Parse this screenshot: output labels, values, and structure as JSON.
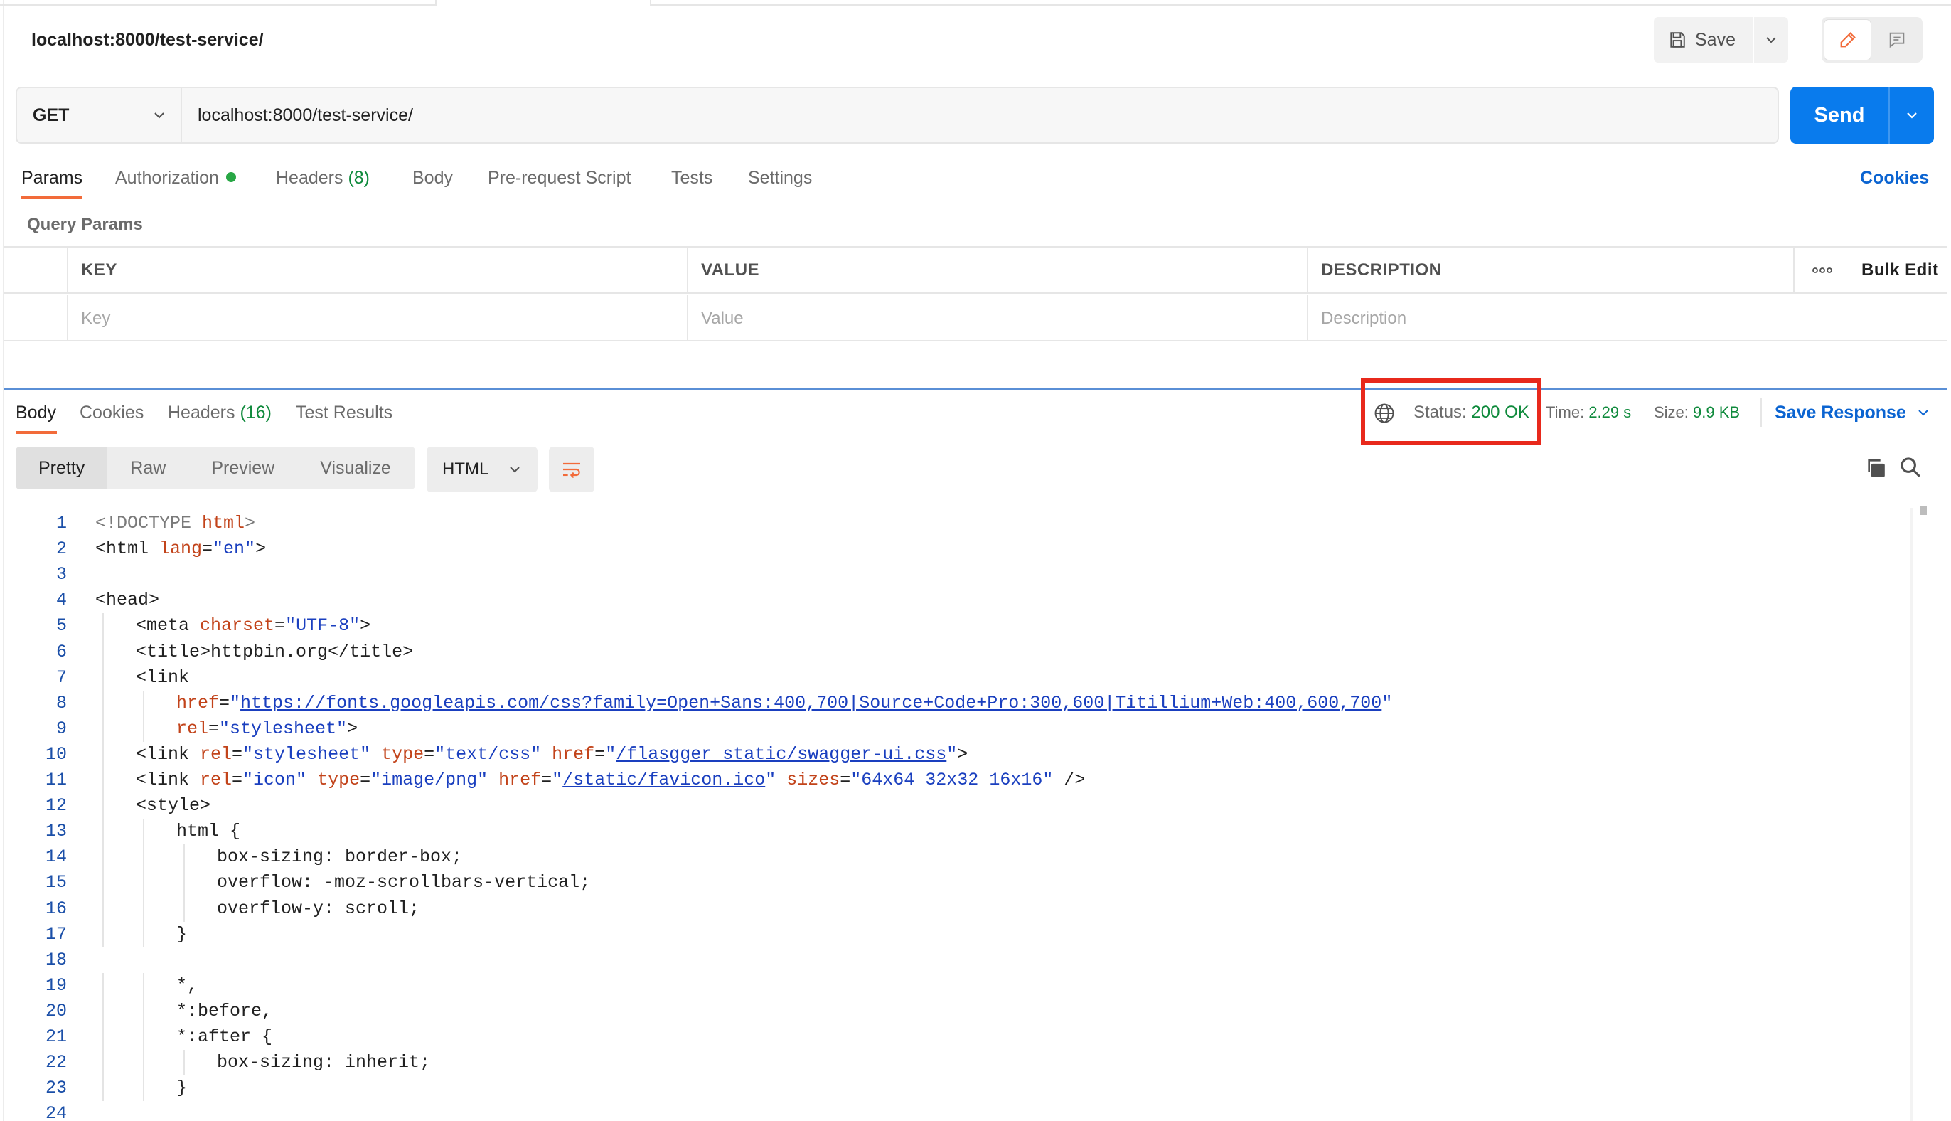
{
  "header": {
    "request_name": "localhost:8000/test-service/",
    "save_label": "Save"
  },
  "request": {
    "method": "GET",
    "url": "localhost:8000/test-service/",
    "send_label": "Send"
  },
  "request_tabs": {
    "params": "Params",
    "authorization": "Authorization",
    "headers": "Headers",
    "headers_count": "(8)",
    "body": "Body",
    "pre_request": "Pre-request Script",
    "tests": "Tests",
    "settings": "Settings",
    "cookies": "Cookies"
  },
  "query_params": {
    "title": "Query Params",
    "columns": {
      "key": "KEY",
      "value": "VALUE",
      "description": "DESCRIPTION",
      "bulk_edit": "Bulk Edit"
    },
    "placeholders": {
      "key": "Key",
      "value": "Value",
      "description": "Description"
    }
  },
  "response_tabs": {
    "body": "Body",
    "cookies": "Cookies",
    "headers": "Headers",
    "headers_count": "(16)",
    "test_results": "Test Results"
  },
  "response_meta": {
    "status_label": "Status:",
    "status_value": "200 OK",
    "time_label": "Time:",
    "time_value": "2.29 s",
    "size_label": "Size:",
    "size_value": "9.9 KB",
    "save_response": "Save Response"
  },
  "viewer": {
    "modes": [
      "Pretty",
      "Raw",
      "Preview",
      "Visualize"
    ],
    "active_mode": "Pretty",
    "language": "HTML"
  },
  "colors": {
    "accent_orange": "#f26b3a",
    "send_blue": "#097bed",
    "link_blue": "#0b64d1",
    "success_green": "#0f8a3c",
    "highlight_red": "#e8291c"
  },
  "code_lines": [
    {
      "n": "1",
      "indent": 0,
      "tokens": [
        [
          "doc",
          "<!DOCTYPE "
        ],
        [
          "attr",
          "html"
        ],
        [
          "doc",
          ">"
        ]
      ]
    },
    {
      "n": "2",
      "indent": 0,
      "tokens": [
        [
          "tag",
          "<html "
        ],
        [
          "attr",
          "lang"
        ],
        [
          "punct",
          "="
        ],
        [
          "str",
          "\"en\""
        ],
        [
          "tag",
          ">"
        ]
      ]
    },
    {
      "n": "3",
      "indent": 0,
      "tokens": []
    },
    {
      "n": "4",
      "indent": 0,
      "tokens": [
        [
          "tag",
          "<head>"
        ]
      ]
    },
    {
      "n": "5",
      "indent": 1,
      "tokens": [
        [
          "tag",
          "<meta "
        ],
        [
          "attr",
          "charset"
        ],
        [
          "punct",
          "="
        ],
        [
          "str",
          "\"UTF-8\""
        ],
        [
          "tag",
          ">"
        ]
      ]
    },
    {
      "n": "6",
      "indent": 1,
      "tokens": [
        [
          "tag",
          "<title>"
        ],
        [
          "punct",
          "httpbin.org"
        ],
        [
          "tag",
          "</title>"
        ]
      ]
    },
    {
      "n": "7",
      "indent": 1,
      "tokens": [
        [
          "tag",
          "<link"
        ]
      ]
    },
    {
      "n": "8",
      "indent": 2,
      "tokens": [
        [
          "attr",
          "href"
        ],
        [
          "punct",
          "="
        ],
        [
          "str",
          "\""
        ],
        [
          "link",
          "https://fonts.googleapis.com/css?family=Open+Sans:400,700|Source+Code+Pro:300,600|Titillium+Web:400,600,700"
        ],
        [
          "str",
          "\""
        ]
      ]
    },
    {
      "n": "9",
      "indent": 2,
      "tokens": [
        [
          "attr",
          "rel"
        ],
        [
          "punct",
          "="
        ],
        [
          "str",
          "\"stylesheet\""
        ],
        [
          "tag",
          ">"
        ]
      ]
    },
    {
      "n": "10",
      "indent": 1,
      "tokens": [
        [
          "tag",
          "<link "
        ],
        [
          "attr",
          "rel"
        ],
        [
          "punct",
          "="
        ],
        [
          "str",
          "\"stylesheet\" "
        ],
        [
          "attr",
          "type"
        ],
        [
          "punct",
          "="
        ],
        [
          "str",
          "\"text/css\" "
        ],
        [
          "attr",
          "href"
        ],
        [
          "punct",
          "="
        ],
        [
          "str",
          "\""
        ],
        [
          "link",
          "/flasgger_static/swagger-ui.css"
        ],
        [
          "str",
          "\""
        ],
        [
          "tag",
          ">"
        ]
      ]
    },
    {
      "n": "11",
      "indent": 1,
      "tokens": [
        [
          "tag",
          "<link "
        ],
        [
          "attr",
          "rel"
        ],
        [
          "punct",
          "="
        ],
        [
          "str",
          "\"icon\" "
        ],
        [
          "attr",
          "type"
        ],
        [
          "punct",
          "="
        ],
        [
          "str",
          "\"image/png\" "
        ],
        [
          "attr",
          "href"
        ],
        [
          "punct",
          "="
        ],
        [
          "str",
          "\""
        ],
        [
          "link",
          "/static/favicon.ico"
        ],
        [
          "str",
          "\" "
        ],
        [
          "attr",
          "sizes"
        ],
        [
          "punct",
          "="
        ],
        [
          "str",
          "\"64x64 32x32 16x16\" "
        ],
        [
          "tag",
          "/>"
        ]
      ]
    },
    {
      "n": "12",
      "indent": 1,
      "tokens": [
        [
          "tag",
          "<style>"
        ]
      ]
    },
    {
      "n": "13",
      "indent": 2,
      "tokens": [
        [
          "punct",
          "html {"
        ]
      ]
    },
    {
      "n": "14",
      "indent": 3,
      "tokens": [
        [
          "punct",
          "box-sizing: border-box;"
        ]
      ]
    },
    {
      "n": "15",
      "indent": 3,
      "tokens": [
        [
          "punct",
          "overflow: -moz-scrollbars-vertical;"
        ]
      ]
    },
    {
      "n": "16",
      "indent": 3,
      "tokens": [
        [
          "punct",
          "overflow-y: scroll;"
        ]
      ]
    },
    {
      "n": "17",
      "indent": 2,
      "tokens": [
        [
          "punct",
          "}"
        ]
      ]
    },
    {
      "n": "18",
      "indent": 0,
      "tokens": []
    },
    {
      "n": "19",
      "indent": 2,
      "tokens": [
        [
          "punct",
          "*,"
        ]
      ]
    },
    {
      "n": "20",
      "indent": 2,
      "tokens": [
        [
          "punct",
          "*:before,"
        ]
      ]
    },
    {
      "n": "21",
      "indent": 2,
      "tokens": [
        [
          "punct",
          "*:after {"
        ]
      ]
    },
    {
      "n": "22",
      "indent": 3,
      "tokens": [
        [
          "punct",
          "box-sizing: inherit;"
        ]
      ]
    },
    {
      "n": "23",
      "indent": 2,
      "tokens": [
        [
          "punct",
          "}"
        ]
      ]
    },
    {
      "n": "24",
      "indent": 0,
      "tokens": []
    }
  ]
}
